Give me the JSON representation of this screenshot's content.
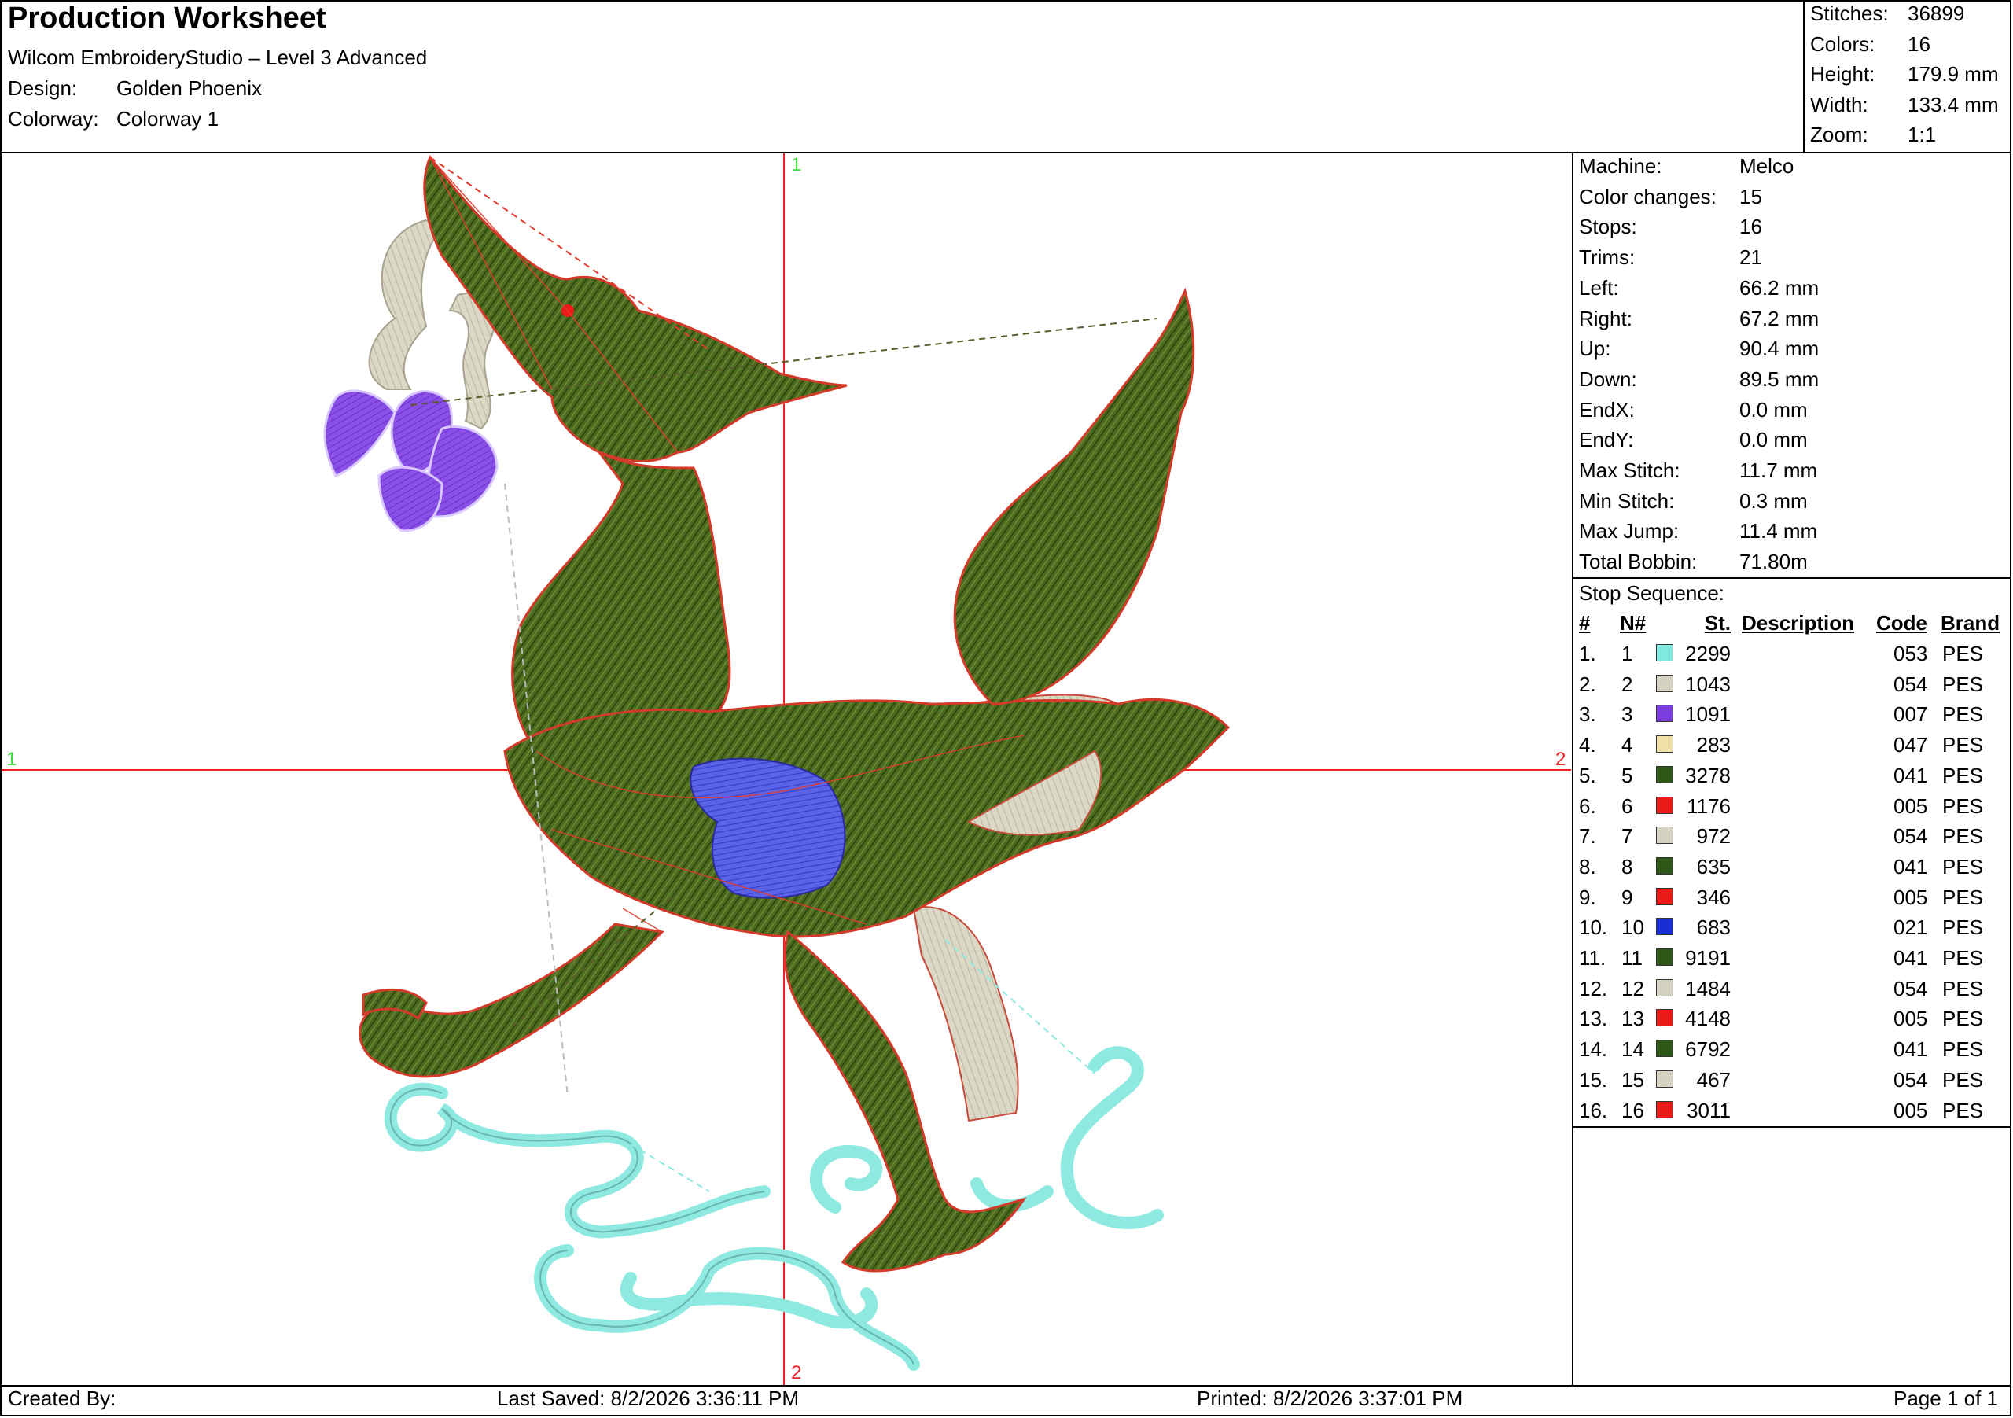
{
  "header": {
    "title": "Production Worksheet",
    "software": "Wilcom EmbroideryStudio – Level 3 Advanced",
    "design_label": "Design:",
    "design_value": "Golden Phoenix",
    "colorway_label": "Colorway:",
    "colorway_value": "Colorway 1"
  },
  "summary": [
    {
      "label": "Stitches:",
      "value": "36899"
    },
    {
      "label": "Colors:",
      "value": "16"
    },
    {
      "label": "Height:",
      "value": "179.9 mm"
    },
    {
      "label": "Width:",
      "value": "133.4 mm"
    },
    {
      "label": "Zoom:",
      "value": "1:1"
    }
  ],
  "machine_info": [
    {
      "label": "Machine:",
      "value": "Melco"
    },
    {
      "label": "Color changes:",
      "value": "15"
    },
    {
      "label": "Stops:",
      "value": "16"
    },
    {
      "label": "Trims:",
      "value": "21"
    },
    {
      "label": "Left:",
      "value": "66.2 mm"
    },
    {
      "label": "Right:",
      "value": "67.2 mm"
    },
    {
      "label": "Up:",
      "value": "90.4 mm"
    },
    {
      "label": "Down:",
      "value": "89.5 mm"
    },
    {
      "label": "EndX:",
      "value": "0.0 mm"
    },
    {
      "label": "EndY:",
      "value": "0.0 mm"
    },
    {
      "label": "Max Stitch:",
      "value": "11.7 mm"
    },
    {
      "label": "Min Stitch:",
      "value": "0.3 mm"
    },
    {
      "label": "Max Jump:",
      "value": "11.4 mm"
    },
    {
      "label": "Total Bobbin:",
      "value": "71.80m"
    }
  ],
  "stop_sequence": {
    "title": "Stop Sequence:",
    "columns": {
      "num": "#",
      "n": "N#",
      "st": "St.",
      "desc": "Description",
      "code": "Code",
      "brand": "Brand"
    },
    "rows": [
      {
        "num": "1.",
        "n": "1",
        "color": "#7fe8df",
        "st": "2299",
        "code": "053",
        "brand": "PES"
      },
      {
        "num": "2.",
        "n": "2",
        "color": "#d6d2c2",
        "st": "1043",
        "code": "054",
        "brand": "PES"
      },
      {
        "num": "3.",
        "n": "3",
        "color": "#7b3de0",
        "st": "1091",
        "code": "007",
        "brand": "PES"
      },
      {
        "num": "4.",
        "n": "4",
        "color": "#efe0a8",
        "st": "283",
        "code": "047",
        "brand": "PES"
      },
      {
        "num": "5.",
        "n": "5",
        "color": "#2c5716",
        "st": "3278",
        "code": "041",
        "brand": "PES"
      },
      {
        "num": "6.",
        "n": "6",
        "color": "#ee1a1a",
        "st": "1176",
        "code": "005",
        "brand": "PES"
      },
      {
        "num": "7.",
        "n": "7",
        "color": "#d6d2c2",
        "st": "972",
        "code": "054",
        "brand": "PES"
      },
      {
        "num": "8.",
        "n": "8",
        "color": "#2c5716",
        "st": "635",
        "code": "041",
        "brand": "PES"
      },
      {
        "num": "9.",
        "n": "9",
        "color": "#ee1a1a",
        "st": "346",
        "code": "005",
        "brand": "PES"
      },
      {
        "num": "10.",
        "n": "10",
        "color": "#1a2ed6",
        "st": "683",
        "code": "021",
        "brand": "PES"
      },
      {
        "num": "11.",
        "n": "11",
        "color": "#2c5716",
        "st": "9191",
        "code": "041",
        "brand": "PES"
      },
      {
        "num": "12.",
        "n": "12",
        "color": "#d6d2c2",
        "st": "1484",
        "code": "054",
        "brand": "PES"
      },
      {
        "num": "13.",
        "n": "13",
        "color": "#ee1a1a",
        "st": "4148",
        "code": "005",
        "brand": "PES"
      },
      {
        "num": "14.",
        "n": "14",
        "color": "#2c5716",
        "st": "6792",
        "code": "041",
        "brand": "PES"
      },
      {
        "num": "15.",
        "n": "15",
        "color": "#d6d2c2",
        "st": "467",
        "code": "054",
        "brand": "PES"
      },
      {
        "num": "16.",
        "n": "16",
        "color": "#ee1a1a",
        "st": "3011",
        "code": "005",
        "brand": "PES"
      }
    ]
  },
  "axis_markers": {
    "top": "1",
    "bottom": "2",
    "left": "1",
    "right": "2"
  },
  "footer": {
    "created_by": "Created By:",
    "last_saved": "Last Saved: 8/2/2026 3:36:11 PM",
    "printed": "Printed: 8/2/2026 3:37:01 PM",
    "page": "Page 1 of 1"
  }
}
